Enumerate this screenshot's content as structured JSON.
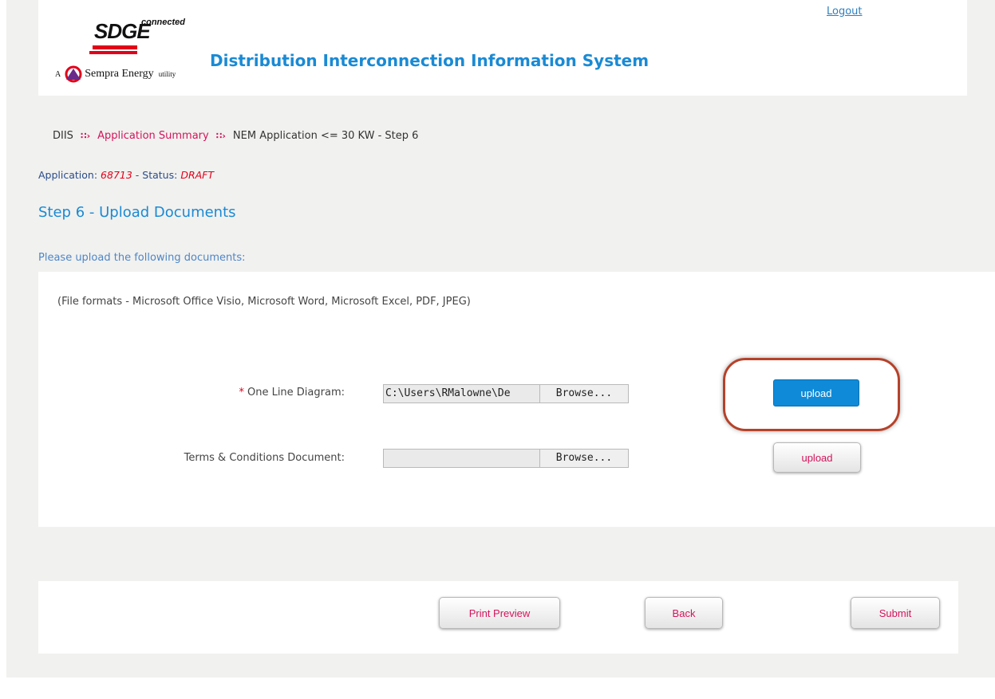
{
  "header": {
    "logo_text": "SDGE",
    "logo_connected": "connected",
    "logo_tagline_prefix": "A",
    "logo_tagline": "Sempra Energy",
    "logo_tagline_suffix": "utility",
    "app_title": "Distribution Interconnection Information System",
    "logout_label": "Logout"
  },
  "breadcrumb": {
    "items": [
      "DIIS",
      "Application Summary",
      "NEM Application <= 30 KW - Step 6"
    ]
  },
  "application": {
    "label": "Application:",
    "number": "68713",
    "status_label": "- Status:",
    "status": "DRAFT"
  },
  "step_title": "Step 6 - Upload Documents",
  "instruction": "Please upload the following documents:",
  "upload": {
    "formats": "(File formats - Microsoft Office Visio, Microsoft Word, Microsoft Excel, PDF, JPEG)",
    "rows": [
      {
        "required": "*",
        "label": "One Line Diagram:",
        "file_value": "C:\\Users\\RMalowne\\De",
        "browse_label": "Browse...",
        "upload_label": "upload"
      },
      {
        "label": "Terms & Conditions Document:",
        "file_value": "",
        "browse_label": "Browse...",
        "upload_label": "upload"
      }
    ]
  },
  "footer": {
    "print_preview_label": "Print Preview",
    "back_label": "Back",
    "submit_label": "Submit"
  },
  "colors": {
    "brand_blue": "#1a8ad4",
    "brand_red": "#e2001a",
    "link_pink": "#d4145a",
    "highlight_ring": "#b5422a"
  }
}
